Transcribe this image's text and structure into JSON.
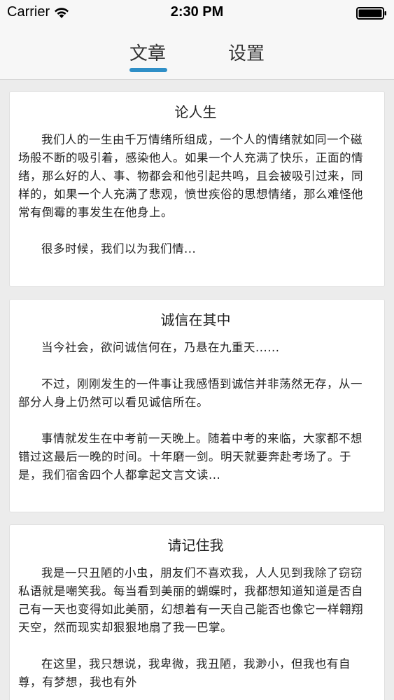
{
  "status_bar": {
    "carrier": "Carrier",
    "time": "2:30 PM"
  },
  "tabs": [
    {
      "label": "文章",
      "active": true
    },
    {
      "label": "设置",
      "active": false
    }
  ],
  "accent_color": "#2f8fc7",
  "articles": [
    {
      "title": "论人生",
      "paragraphs": [
        "我们人的一生由千万情绪所组成，一个人的情绪就如同一个磁场般不断的吸引着，感染他人。如果一个人充满了快乐，正面的情绪，那么好的人、事、物都会和他引起共鸣，且会被吸引过来，同样的，如果一个人充满了悲观，愤世疾俗的思想情绪，那么难怪他常有倒霉的事发生在他身上。",
        "很多时候，我们以为我们情..."
      ]
    },
    {
      "title": "诚信在其中",
      "paragraphs": [
        "当今社会，欲问诚信何在，乃悬在九重天......",
        "不过，刚刚发生的一件事让我感悟到诚信并非荡然无存，从一部分人身上仍然可以看见诚信所在。",
        "事情就发生在中考前一天晚上。随着中考的来临，大家都不想错过这最后一晚的时间。十年磨一剑。明天就要奔赴考场了。于是，我们宿舍四个人都拿起文言文读..."
      ]
    },
    {
      "title": "请记住我",
      "paragraphs": [
        "我是一只丑陋的小虫，朋友们不喜欢我，人人见到我除了窃窃私语就是嘲笑我。每当看到美丽的蝴蝶时，我都想知道知道是否自己有一天也变得如此美丽，幻想着有一天自己能否也像它一样翱翔天空，然而现实却狠狠地扇了我一巴掌。",
        "在这里，我只想说，我卑微，我丑陋，我渺小，但我也有自尊，有梦想，我也有外"
      ]
    }
  ]
}
